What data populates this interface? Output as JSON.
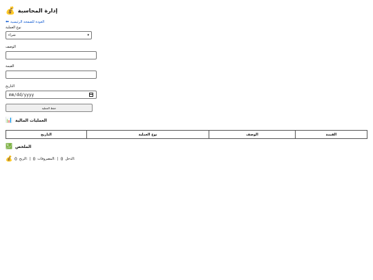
{
  "header": {
    "icon": "money-bag-icon",
    "icon_glyph": "💰",
    "title": "إدارة المحاسبة"
  },
  "nav": {
    "back_label": "العودة للصفحة الرئيسية",
    "back_arrow": "⬅"
  },
  "form": {
    "type_label": "نوع العملية",
    "type_value": "شراء",
    "description_label": "الوصف",
    "description_value": "",
    "amount_label": "القيمة",
    "amount_value": "",
    "date_label": "التاريخ",
    "date_placeholder": "mm/dd/yyyy",
    "save_label": "حفظ العملية"
  },
  "transactions": {
    "icon": "chart-icon",
    "icon_glyph": "📊",
    "title": "العمليات المالية",
    "columns": [
      "التاريخ",
      "نوع العملية",
      "الوصف",
      "القيمة"
    ]
  },
  "summary": {
    "icon": "chart-increasing-icon",
    "icon_glyph": "💹",
    "title": "الملخص",
    "income_label": "الدخل:",
    "income_value": "0",
    "expenses_label": "المصروفات:",
    "expenses_value": "0",
    "profit_label": "الربح:",
    "profit_value": "0",
    "profit_icon": "money-bag-icon",
    "profit_icon_glyph": "💰"
  }
}
